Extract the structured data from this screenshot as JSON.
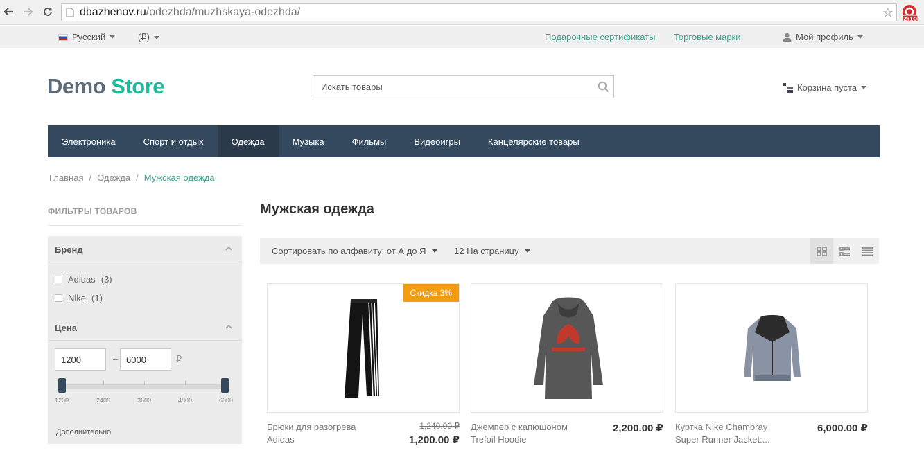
{
  "browser": {
    "url_host": "dbazhenov.ru",
    "url_path": "/odezhda/muzhskaya-odezhda/",
    "extension_badge": "2:10"
  },
  "topbar": {
    "language": "Русский",
    "currency": "(₽)",
    "links": [
      "Подарочные сертификаты",
      "Торговые марки"
    ],
    "profile": "Мой профиль"
  },
  "header": {
    "logo_part1": "Demo",
    "logo_part2": "Store",
    "search_placeholder": "Искать товары",
    "cart": "Корзина пуста"
  },
  "menu": [
    {
      "label": "Электроника",
      "active": false
    },
    {
      "label": "Спорт и отдых",
      "active": false
    },
    {
      "label": "Одежда",
      "active": true
    },
    {
      "label": "Музыка",
      "active": false
    },
    {
      "label": "Фильмы",
      "active": false
    },
    {
      "label": "Видеоигры",
      "active": false
    },
    {
      "label": "Канцелярские товары",
      "active": false
    }
  ],
  "breadcrumb": {
    "items": [
      "Главная",
      "Одежда"
    ],
    "separator": "/",
    "current": "Мужская одежда"
  },
  "filters": {
    "title": "ФИЛЬТРЫ ТОВАРОВ",
    "brand": {
      "title": "Бренд",
      "options": [
        {
          "label": "Adidas",
          "count": "(3)"
        },
        {
          "label": "Nike",
          "count": "(1)"
        }
      ]
    },
    "price": {
      "title": "Цена",
      "min_value": "1200",
      "max_value": "6000",
      "dash": "–",
      "currency": "₽",
      "ticks": [
        "1200",
        "2400",
        "3600",
        "4800",
        "6000"
      ],
      "range_selected": [
        1200,
        6000
      ]
    },
    "more": "Дополнительно"
  },
  "content": {
    "title": "Мужская одежда",
    "sort": "Сортировать по алфавиту: от А до Я",
    "per_page": "12 На страницу"
  },
  "products": [
    {
      "name": "Брюки для разогрева Adidas",
      "old_price": "1,240.00 ₽",
      "price": "1,200.00 ₽",
      "badge": "Скидка 3%"
    },
    {
      "name": "Джемпер с капюшоном Trefoil Hoodie",
      "old_price": "",
      "price": "2,200.00 ₽",
      "badge": ""
    },
    {
      "name": "Куртка Nike Chambray Super Runner Jacket:...",
      "old_price": "",
      "price": "6,000.00 ₽",
      "badge": ""
    }
  ],
  "colors": {
    "accent": "#1abc9c",
    "link": "#3aa58c",
    "menu_bg": "#34495e",
    "badge": "#f39c12"
  }
}
